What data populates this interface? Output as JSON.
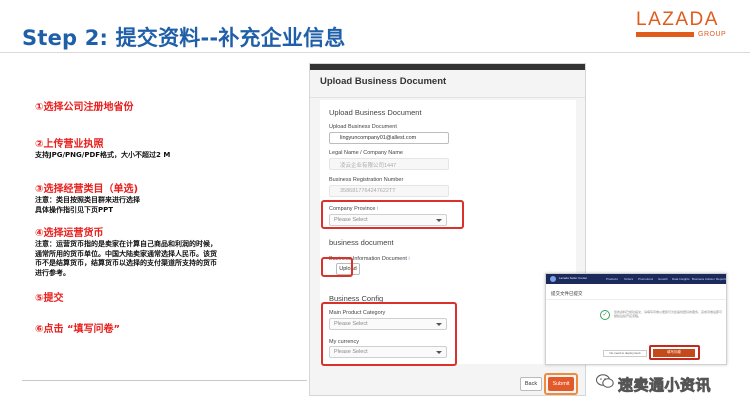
{
  "slide": {
    "title": "Step 2: 提交资料--补充企业信息"
  },
  "logo": {
    "word": "LAZADA",
    "sub": "GROUP",
    "color": "#e05b1c"
  },
  "steps": [
    {
      "head": "①选择公司注册地省份",
      "notes": []
    },
    {
      "head": "②上传营业执照",
      "notes": [
        "支持JPG/PNG/PDF格式，大小不超过2 M"
      ]
    },
    {
      "head": "③选择经营类目（单选)",
      "notes": [
        "注意：类目按照类目群来进行选择",
        "具体操作指引见下页PPT"
      ]
    },
    {
      "head": "④选择运营货币",
      "notes": [
        "注意：运营货币指的是卖家在计算自己商品和利润的时候，",
        "通常所用的货币单位。中国大陆卖家通常选择人民币。该货",
        "币不是结算货币，结算货币以选择的支付渠道所支持的货币",
        "进行参考。"
      ]
    },
    {
      "head": "⑤提交",
      "notes": []
    },
    {
      "head": "⑥点击 “填写问卷”",
      "notes": []
    }
  ],
  "form": {
    "window_title": "Upload Business Document",
    "section1_title": "Upload Business Document",
    "email_label": "Upload Business Document",
    "email_value": "lingyuncompany01@allest.com",
    "legal_name_label": "Legal Name / Company Name",
    "legal_name_value": "凌云企业有限公司1447",
    "reg_number_label": "Business Registration Number",
    "reg_number_value": "3586817764247622TT",
    "province_label": "Company Province",
    "province_placeholder": "Please Select",
    "section2_title": "business document",
    "doc_label": "Business Information Document",
    "upload_label": "Upload",
    "section3_title": "Business Config",
    "category_label": "Main Product Category",
    "category_placeholder": "Please Select",
    "currency_label": "My currency",
    "currency_placeholder": "Please Select",
    "info_icon": "i",
    "back_label": "Back",
    "submit_label": "Submit"
  },
  "inset": {
    "page_title": "提交文件已提交",
    "nav_brand": "Lazada Seller Center",
    "nav_items": [
      "Products",
      "Orders",
      "Promotions",
      "Growth",
      "Data Insights",
      "Business Advisor",
      "Reports"
    ],
    "message": "您的资料已成功提交，请填写问卷以便我们为您提供更好的服务，完成问卷后即可继续后续开店流程。",
    "button_left": "No need to deployment",
    "button_right": "填写问卷"
  },
  "watermark": {
    "text": "速卖通小资讯"
  },
  "colors": {
    "title_blue": "#1f5fa8",
    "highlight_red": "#d8322b",
    "submit_orange": "#e2592a"
  }
}
